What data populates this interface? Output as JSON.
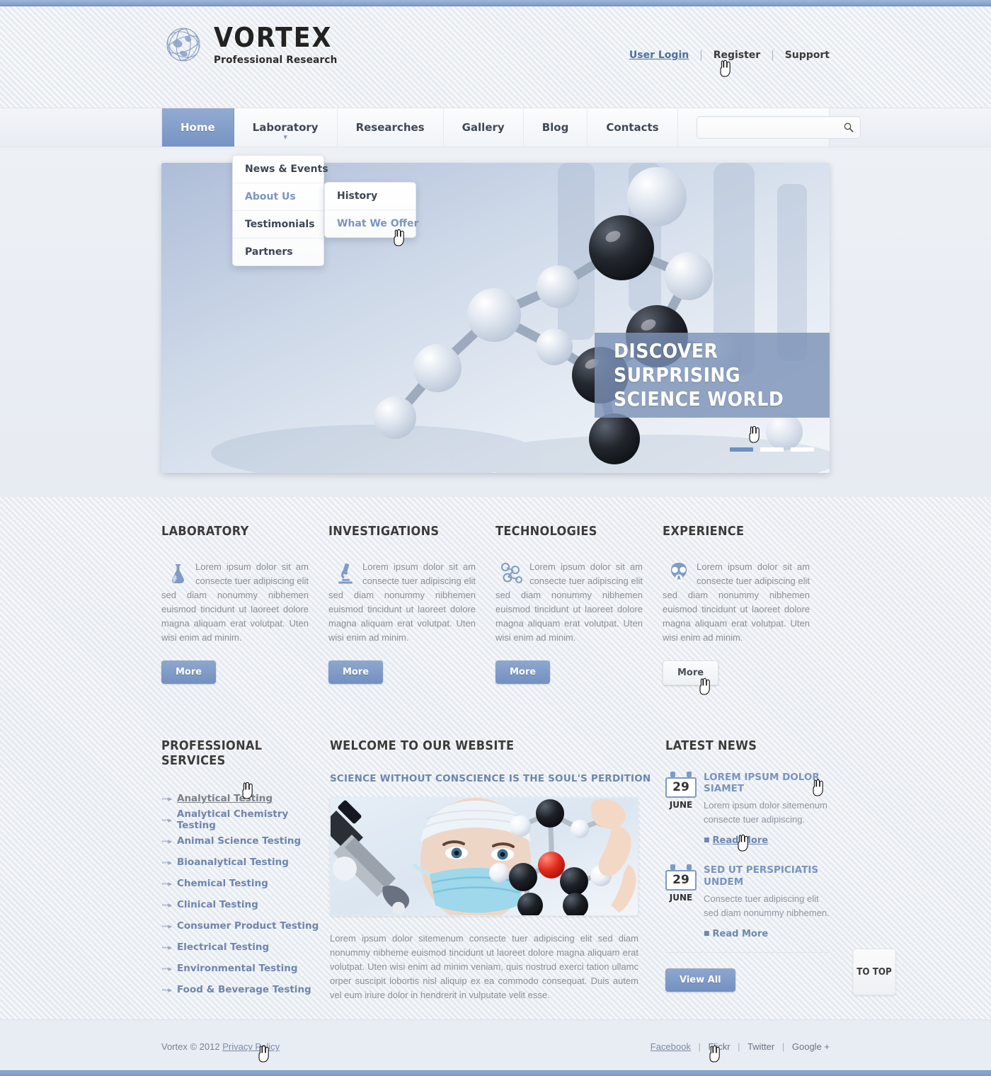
{
  "brand": {
    "name": "VORTEX",
    "tagline": "Professional Research",
    "logo_icon": "globe-icon"
  },
  "topbar": {
    "links": [
      {
        "label": "User Login",
        "active": true
      },
      {
        "label": "Register",
        "active": false
      },
      {
        "label": "Support",
        "active": false
      }
    ],
    "separator": "|"
  },
  "nav": {
    "items": [
      {
        "label": "Home",
        "active": true,
        "has_caret": false
      },
      {
        "label": "Laboratory",
        "active": false,
        "has_caret": true
      },
      {
        "label": "Researches",
        "active": false,
        "has_caret": false
      },
      {
        "label": "Gallery",
        "active": false,
        "has_caret": false
      },
      {
        "label": "Blog",
        "active": false,
        "has_caret": false
      },
      {
        "label": "Contacts",
        "active": false,
        "has_caret": false
      }
    ],
    "search": {
      "value": "",
      "placeholder": "",
      "icon": "search-icon"
    }
  },
  "dropdown_primary": {
    "items": [
      {
        "label": "News & Events",
        "highlight": false
      },
      {
        "label": "About Us",
        "highlight": true
      },
      {
        "label": "Testimonials",
        "highlight": false
      },
      {
        "label": "Partners",
        "highlight": false
      }
    ]
  },
  "dropdown_secondary": {
    "items": [
      {
        "label": "History",
        "highlight": false
      },
      {
        "label": "What We Offer",
        "highlight": true
      }
    ]
  },
  "hero": {
    "caption_line1": "DISCOVER SURPRISING",
    "caption_line2": "SCIENCE WORLD",
    "pager": [
      {
        "active": true
      },
      {
        "active": false
      },
      {
        "active": false
      }
    ]
  },
  "features": [
    {
      "title": "LABORATORY",
      "icon": "flask-icon",
      "text": "Lorem ipsum dolor sit am consecte tuer adipiscing elit sed diam nonummy nibhemen euismod tincidunt ut laoreet dolore magna aliquam erat volutpat. Uten wisi enim ad minim.",
      "button": "More",
      "button_style": "primary"
    },
    {
      "title": "INVESTIGATIONS",
      "icon": "microscope-icon",
      "text": "Lorem ipsum dolor sit am consecte tuer adipiscing elit sed diam nonummy nibhemen euismod tincidunt ut laoreet dolore magna aliquam erat volutpat. Uten wisi enim ad minim.",
      "button": "More",
      "button_style": "primary"
    },
    {
      "title": "TECHNOLOGIES",
      "icon": "molecule-icon",
      "text": "Lorem ipsum dolor sit am consecte tuer adipiscing elit sed diam nonummy nibhemen euismod tincidunt ut laoreet dolore magna aliquam erat volutpat. Uten wisi enim ad minim.",
      "button": "More",
      "button_style": "primary"
    },
    {
      "title": "EXPERIENCE",
      "icon": "gasmask-icon",
      "text": "Lorem ipsum dolor sit am consecte tuer adipiscing elit sed diam nonummy nibhemen euismod tincidunt ut laoreet dolore magna aliquam erat volutpat. Uten wisi enim ad minim.",
      "button": "More",
      "button_style": "ghost"
    }
  ],
  "services": {
    "title": "PROFESSIONAL SERVICES",
    "items": [
      {
        "label": "Analytical Testing",
        "active": true
      },
      {
        "label": "Analytical Chemistry Testing",
        "active": false
      },
      {
        "label": "Animal Science Testing",
        "active": false
      },
      {
        "label": "Bioanalytical Testing",
        "active": false
      },
      {
        "label": "Chemical Testing",
        "active": false
      },
      {
        "label": "Clinical Testing",
        "active": false
      },
      {
        "label": "Consumer Product Testing",
        "active": false
      },
      {
        "label": "Electrical Testing",
        "active": false
      },
      {
        "label": "Environmental Testing",
        "active": false
      },
      {
        "label": "Food & Beverage Testing",
        "active": false
      }
    ]
  },
  "welcome": {
    "title": "WELCOME TO OUR WEBSITE",
    "subtitle": "SCIENCE WITHOUT CONSCIENCE IS THE SOUL'S PERDITION",
    "image_alt": "scientist-with-molecule-model-photo",
    "text": "Lorem ipsum dolor sitemenum consecte tuer adipiscing elit sed diam nonummy nibheme euismod tincidunt ut laoreet dolore magna aliquam erat volutpat. Uten wisi enim ad minim veniam, quis nostrud exerci tation ullamc orper suscipit lobortis nisl aliquip ex ea commodo consequat. Duis autem vel eum iriure dolor in hendrerit in vulputate velit esse."
  },
  "news": {
    "title": "LATEST NEWS",
    "items": [
      {
        "day": "29",
        "month": "JUNE",
        "title": "LOREM IPSUM DOLOR SIAMET",
        "text": "Lorem ipsum dolor sitemenum consecte tuer adipiscing.",
        "read_more": "Read More",
        "read_more_active": true
      },
      {
        "day": "29",
        "month": "JUNE",
        "title": "SED UT PERSPICIATIS UNDEM",
        "text": "Consecte tuer adipiscing elit sed diam nonummy nibhemen.",
        "read_more": "Read More",
        "read_more_active": false
      }
    ],
    "view_all": "View All"
  },
  "to_top": {
    "label": "TO TOP"
  },
  "footer": {
    "copyright": "Vortex © 2012",
    "privacy": "Privacy Policy",
    "social": [
      {
        "label": "Facebook",
        "active": true
      },
      {
        "label": "Flickr",
        "active": false
      },
      {
        "label": "Twitter",
        "active": false
      },
      {
        "label": "Google +",
        "active": false
      }
    ],
    "separator": "|"
  },
  "colors": {
    "accent": "#7693c4",
    "accent_light": "#93abd0",
    "link": "#6e86ae",
    "page_bg": "#eceff4",
    "heading": "#3b3b3b",
    "body_text": "#8a8f96"
  }
}
